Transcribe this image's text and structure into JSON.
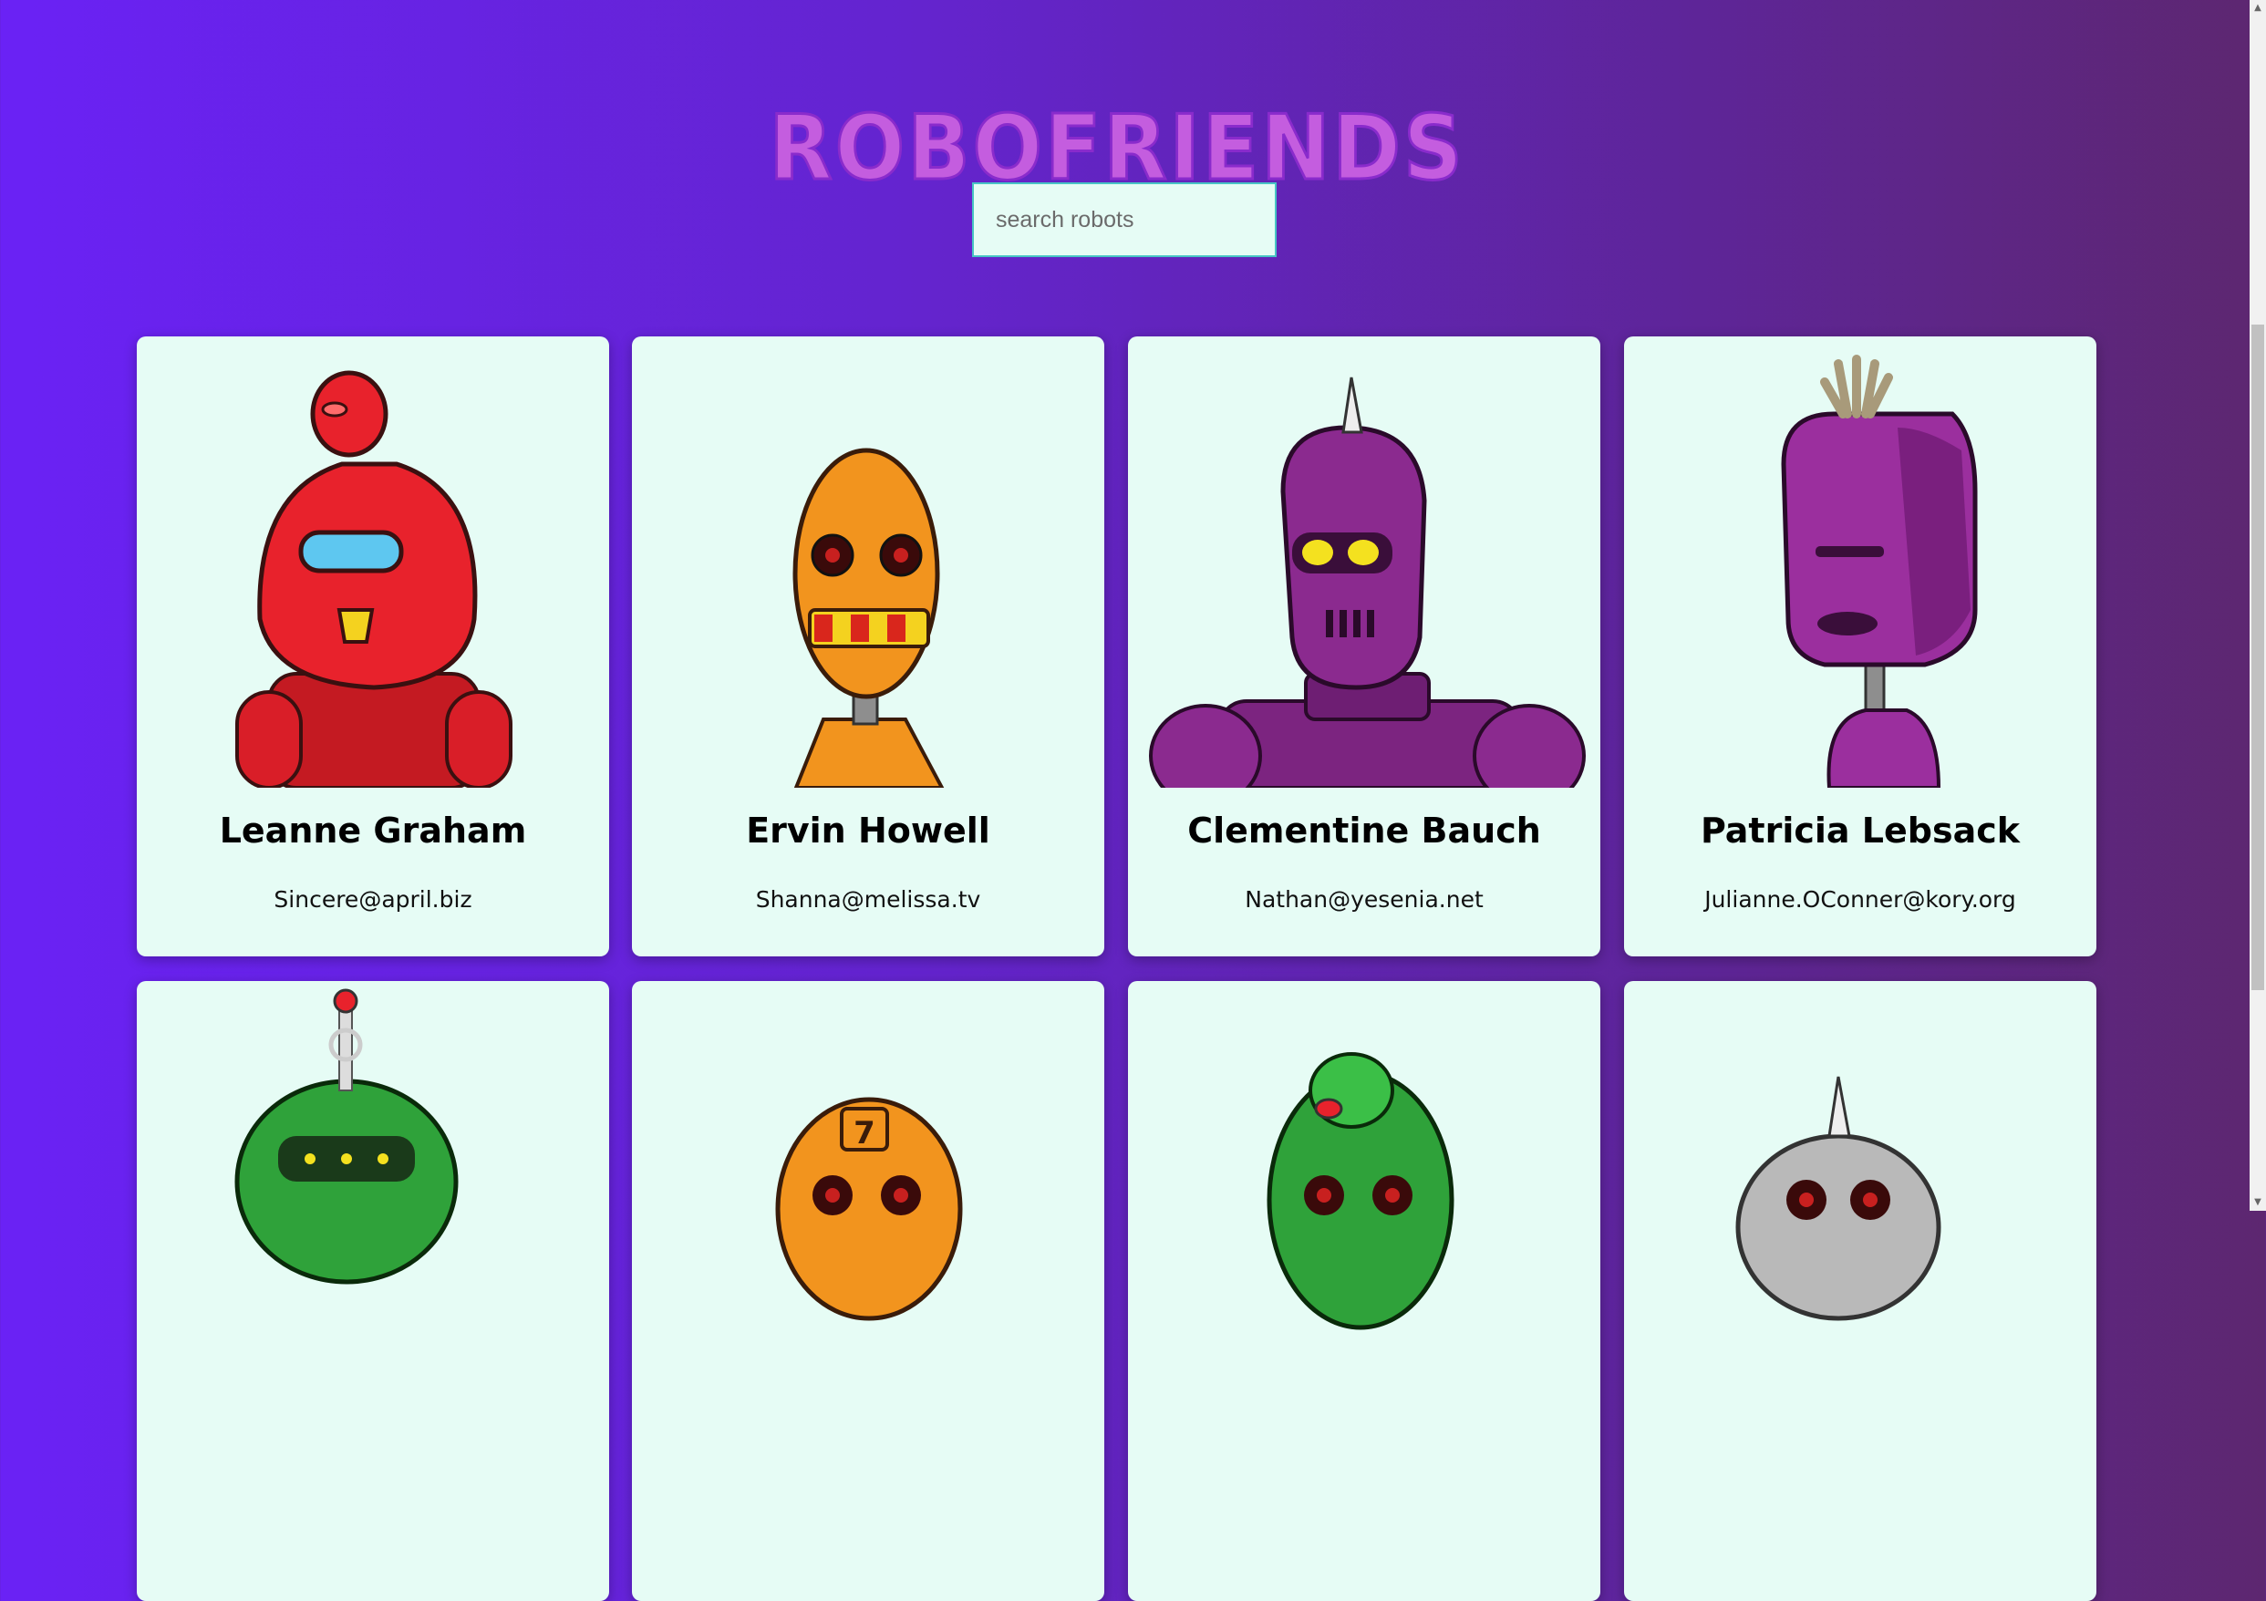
{
  "header": {
    "title": "ROBOFRIENDS"
  },
  "search": {
    "placeholder": "search robots",
    "value": ""
  },
  "robots": [
    {
      "name": "Leanne Graham",
      "email": "Sincere@april.biz",
      "color": "#e8222c"
    },
    {
      "name": "Ervin Howell",
      "email": "Shanna@melissa.tv",
      "color": "#f2941e"
    },
    {
      "name": "Clementine Bauch",
      "email": "Nathan@yesenia.net",
      "color": "#8b2a8f"
    },
    {
      "name": "Patricia Lebsack",
      "email": "Julianne.OConner@kory.org",
      "color": "#9b2f9e"
    },
    {
      "name": "",
      "email": "",
      "color": "#2fa23a"
    },
    {
      "name": "",
      "email": "",
      "color": "#f2941e"
    },
    {
      "name": "",
      "email": "",
      "color": "#2fa23a"
    },
    {
      "name": "",
      "email": "",
      "color": "#b9b9b9"
    }
  ],
  "colors": {
    "accent": "#c45ddf",
    "card_bg": "#e6fcf5",
    "input_border": "#47c4c4"
  }
}
